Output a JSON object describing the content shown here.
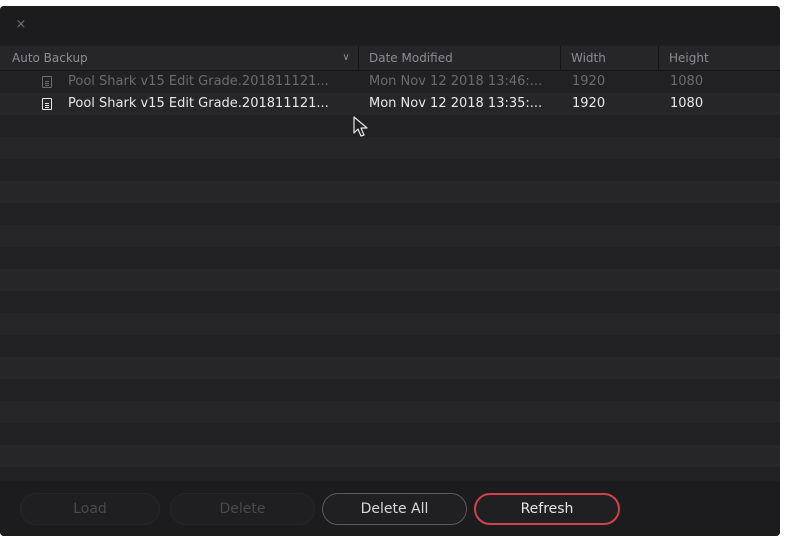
{
  "titlebar": {
    "close_glyph": "×"
  },
  "columns": {
    "name": "Auto Backup",
    "date": "Date Modified",
    "width": "Width",
    "height": "Height",
    "sort_glyph": "∨"
  },
  "rows": [
    {
      "icon": "file-icon",
      "name": "Pool Shark v15 Edit Grade.201811121...",
      "date": "Mon Nov 12 2018 13:46:...",
      "width": "1920",
      "height": "1080",
      "state": "dim"
    },
    {
      "icon": "file-icon",
      "name": "Pool Shark v15 Edit Grade.201811121...",
      "date": "Mon Nov 12 2018 13:35:...",
      "width": "1920",
      "height": "1080",
      "state": "active"
    }
  ],
  "buttons": {
    "load": "Load",
    "delete": "Delete",
    "delete_all": "Delete All",
    "refresh": "Refresh"
  },
  "colors": {
    "background": "#1f1f21",
    "accent": "#d0434d"
  }
}
